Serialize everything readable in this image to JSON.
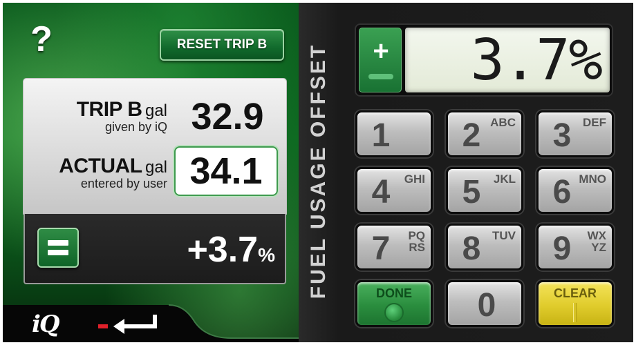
{
  "left_panel": {
    "help_label": "?",
    "reset_button_label": "RESET TRIP B",
    "trip_b": {
      "title": "TRIP B",
      "unit": "gal",
      "subtitle": "given by iQ",
      "value": "32.9"
    },
    "actual": {
      "title": "ACTUAL",
      "unit": "gal",
      "subtitle": "entered by user",
      "value": "34.1"
    },
    "result": {
      "value": "+3.7",
      "unit": "%"
    },
    "logo_text": "iQ"
  },
  "right_panel": {
    "title": "FUEL USAGE OFFSET",
    "sign_plus": "+",
    "display_value": "3.7%",
    "keys": [
      {
        "digit": "1",
        "letters": ""
      },
      {
        "digit": "2",
        "letters": "ABC"
      },
      {
        "digit": "3",
        "letters": "DEF"
      },
      {
        "digit": "4",
        "letters": "GHI"
      },
      {
        "digit": "5",
        "letters": "JKL"
      },
      {
        "digit": "6",
        "letters": "MNO"
      },
      {
        "digit": "7",
        "letters": "PQ\nRS"
      },
      {
        "digit": "8",
        "letters": "TUV"
      },
      {
        "digit": "9",
        "letters": "WX\nYZ"
      },
      {
        "digit": "0",
        "letters": ""
      }
    ],
    "done_label": "DONE",
    "clear_label": "CLEAR"
  },
  "colors": {
    "accent_green": "#197233",
    "clear_yellow": "#e0cc2c",
    "back_arrow_red": "#e0202a"
  }
}
